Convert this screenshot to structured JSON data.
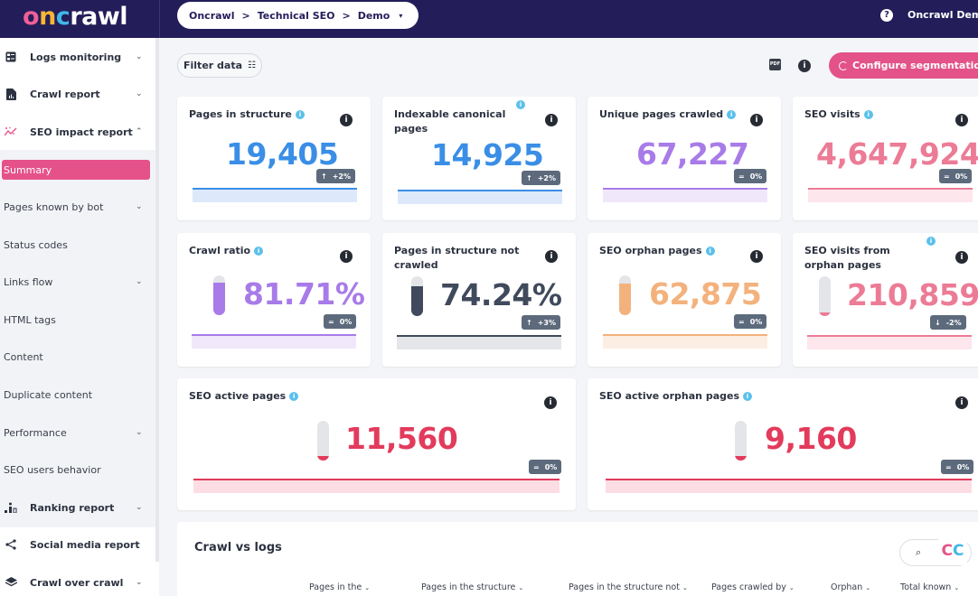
{
  "header": {
    "logo": [
      "o",
      "n",
      "c",
      "rawl"
    ],
    "breadcrumb": [
      "Oncrawl",
      "Technical SEO",
      "Demo"
    ],
    "breadcrumb_separator": ">",
    "breadcrumb_caret": "▾",
    "help_icon": "?",
    "user_name": "Oncrawl Demo"
  },
  "sidebar": {
    "sections": [
      {
        "label": "Logs monitoring",
        "icon": "logs-icon",
        "expanded": false
      },
      {
        "label": "Crawl report",
        "icon": "report-file-icon",
        "expanded": false
      },
      {
        "label": "SEO impact report",
        "icon": "seo-impact-icon",
        "expanded": true
      },
      {
        "label": "Ranking report",
        "icon": "ranking-icon",
        "expanded": false
      },
      {
        "label": "Social media report",
        "icon": "share-icon",
        "expanded": false
      },
      {
        "label": "Crawl over crawl",
        "icon": "layers-icon",
        "expanded": false
      }
    ],
    "sub_items": [
      {
        "label": "Summary",
        "active": true,
        "expandable": false
      },
      {
        "label": "Pages known by bot",
        "active": false,
        "expandable": true
      },
      {
        "label": "Status codes",
        "active": false,
        "expandable": false
      },
      {
        "label": "Links flow",
        "active": false,
        "expandable": true
      },
      {
        "label": "HTML tags",
        "active": false,
        "expandable": false
      },
      {
        "label": "Content",
        "active": false,
        "expandable": false
      },
      {
        "label": "Duplicate content",
        "active": false,
        "expandable": false
      },
      {
        "label": "Performance",
        "active": false,
        "expandable": true
      },
      {
        "label": "SEO users behavior",
        "active": false,
        "expandable": false
      }
    ],
    "chevron_down": "⌄",
    "chevron_up": "⌃"
  },
  "toolbar": {
    "filter_label": "Filter data",
    "filter_icon": "☷",
    "pdf_label": "PDF",
    "info": "i",
    "configure_label": "Configure segmentation"
  },
  "cards": [
    {
      "title": "Pages in structure",
      "value": "19,405",
      "delta": "+2%",
      "trend": "↑",
      "color": "#3a8ee6",
      "area": "#dde9fa"
    },
    {
      "title": "Indexable canonical pages",
      "value": "14,925",
      "delta": "+2%",
      "trend": "↑",
      "color": "#3a8ee6",
      "area": "#dde9fa"
    },
    {
      "title": "Unique pages crawled",
      "value": "67,227",
      "delta": "0%",
      "trend": "=",
      "color": "#a87be8",
      "area": "#f1e7fb"
    },
    {
      "title": "SEO visits",
      "value": "4,647,924",
      "delta": "0%",
      "trend": "=",
      "color": "#ec7b96",
      "area": "#fde6ec"
    },
    {
      "title": "Crawl ratio",
      "value": "81.71%",
      "delta": "0%",
      "trend": "=",
      "color": "#a87be8",
      "area": "#f1e7fb",
      "gauge": 0.8171
    },
    {
      "title": "Pages in structure not crawled",
      "value": "74.24%",
      "delta": "+3%",
      "trend": "↑",
      "color": "#3f4a5c",
      "area": "#e4e6e9",
      "gauge": 0.7424
    },
    {
      "title": "SEO orphan pages",
      "value": "62,875",
      "delta": "0%",
      "trend": "=",
      "color": "#f3b27d",
      "area": "#fdeee3",
      "gauge": 0.8
    },
    {
      "title": "SEO visits from orphan pages",
      "value": "210,859",
      "delta": "-2%",
      "trend": "↓",
      "color": "#ec7b96",
      "area": "#fde6ec",
      "gauge": 0.05
    },
    {
      "title": "SEO active pages",
      "value": "11,560",
      "delta": "0%",
      "trend": "=",
      "color": "#e23b5c",
      "area": "#fcdde3",
      "gauge": 0.12
    },
    {
      "title": "SEO active orphan pages",
      "value": "9,160",
      "delta": "0%",
      "trend": "=",
      "color": "#e23b5c",
      "area": "#fcdde3",
      "gauge": 0.12
    }
  ],
  "crawl_vs_logs": {
    "title": "Crawl vs logs",
    "search_icon": "⌕",
    "columns": [
      "Pages in the",
      "Pages in the structure",
      "Pages in the structure not",
      "Pages crawled by",
      "Orphan",
      "Total known"
    ],
    "sort_icon": "⌄",
    "logo": [
      "C",
      "C"
    ]
  }
}
